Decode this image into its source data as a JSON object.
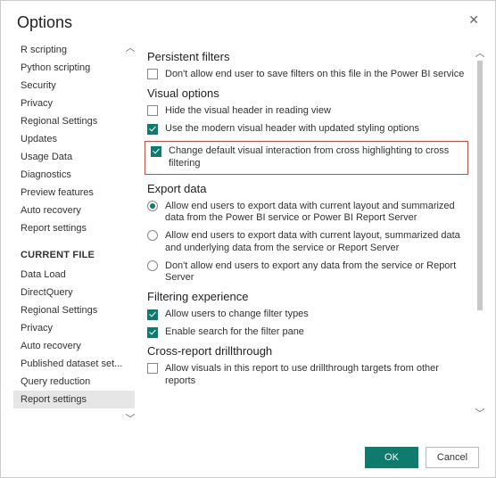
{
  "window": {
    "title": "Options"
  },
  "sidebar": {
    "items_global": [
      "R scripting",
      "Python scripting",
      "Security",
      "Privacy",
      "Regional Settings",
      "Updates",
      "Usage Data",
      "Diagnostics",
      "Preview features",
      "Auto recovery",
      "Report settings"
    ],
    "heading": "CURRENT FILE",
    "items_current": [
      "Data Load",
      "DirectQuery",
      "Regional Settings",
      "Privacy",
      "Auto recovery",
      "Published dataset set...",
      "Query reduction",
      "Report settings"
    ],
    "selected_index_current": 7
  },
  "sections": {
    "persistent": {
      "title": "Persistent filters",
      "opt1": {
        "checked": false,
        "label": "Don't allow end user to save filters on this file in the Power BI service"
      }
    },
    "visual": {
      "title": "Visual options",
      "opt1": {
        "checked": false,
        "label": "Hide the visual header in reading view"
      },
      "opt2": {
        "checked": true,
        "label": "Use the modern visual header with updated styling options"
      },
      "opt3": {
        "checked": true,
        "label": "Change default visual interaction from cross highlighting to cross filtering"
      }
    },
    "export": {
      "title": "Export data",
      "selected": 0,
      "opts": [
        "Allow end users to export data with current layout and summarized data from the Power BI service or Power BI Report Server",
        "Allow end users to export data with current layout, summarized data and underlying data from the service or Report Server",
        "Don't allow end users to export any data from the service or Report Server"
      ]
    },
    "filtering": {
      "title": "Filtering experience",
      "opt1": {
        "checked": true,
        "label": "Allow users to change filter types"
      },
      "opt2": {
        "checked": true,
        "label": "Enable search for the filter pane"
      }
    },
    "crossreport": {
      "title": "Cross-report drillthrough",
      "opt1": {
        "checked": false,
        "label": "Allow visuals in this report to use drillthrough targets from other reports"
      }
    }
  },
  "buttons": {
    "ok": "OK",
    "cancel": "Cancel"
  }
}
